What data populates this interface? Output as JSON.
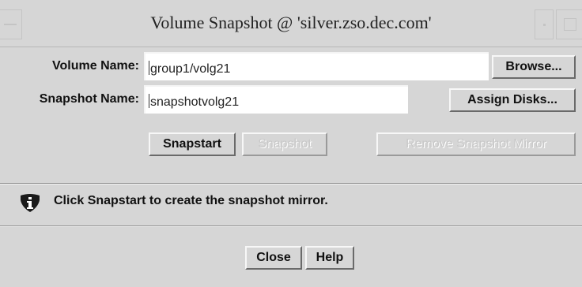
{
  "window": {
    "title": "Volume Snapshot @ 'silver.zso.dec.com'"
  },
  "form": {
    "volume_name_label": "Volume Name:",
    "volume_name_value": "group1/volg21",
    "snapshot_name_label": "Snapshot Name:",
    "snapshot_name_value": "snapshotvolg21",
    "browse_label": "Browse...",
    "assign_disks_label": "Assign Disks..."
  },
  "actions": {
    "snapstart_label": "Snapstart",
    "snapshot_label": "Snapshot",
    "remove_mirror_label": "Remove Snapshot Mirror"
  },
  "status": {
    "icon": "info-icon",
    "message": "Click Snapstart to create the snapshot mirror."
  },
  "footer": {
    "close_label": "Close",
    "help_label": "Help"
  }
}
